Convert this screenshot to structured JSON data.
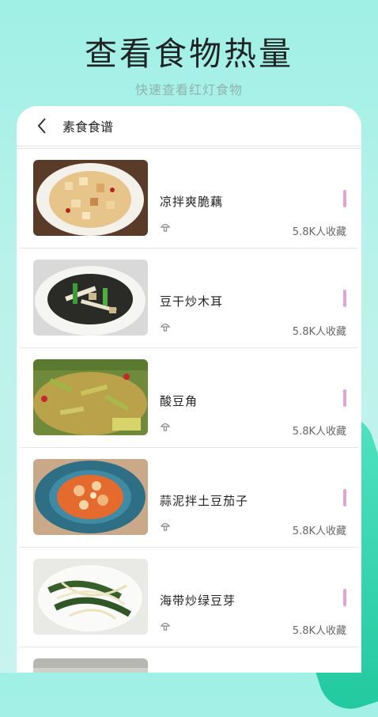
{
  "header": {
    "title": "查看食物热量",
    "subtitle": "快速查看红灯食物"
  },
  "navbar": {
    "title": "素食食谱",
    "back_icon": "chevron-left-icon"
  },
  "items": [
    {
      "name": "凉拌爽脆藕",
      "favorites": "5.8K人收藏",
      "image": "tofu-dish"
    },
    {
      "name": "豆干炒木耳",
      "favorites": "5.8K人收藏",
      "image": "fungus-dish"
    },
    {
      "name": "酸豆角",
      "favorites": "5.8K人收藏",
      "image": "beans-dish"
    },
    {
      "name": "蒜泥拌土豆茄子",
      "favorites": "5.8K人收藏",
      "image": "eggplant-dish"
    },
    {
      "name": "海带炒绿豆芽",
      "favorites": "5.8K人收藏",
      "image": "seaweed-dish"
    }
  ],
  "colors": {
    "accent_bar": "#e2a3d6",
    "bg_top": "#9ff0e6",
    "wave": "#21c89e"
  }
}
